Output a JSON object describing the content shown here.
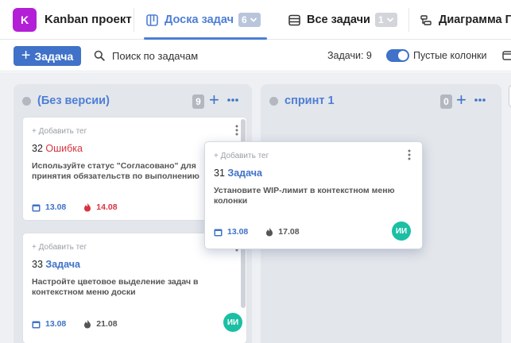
{
  "project": {
    "logo_letter": "K",
    "name": "Kanban проект",
    "logo_color": "#b31fd6"
  },
  "tabs": [
    {
      "label": "Доска задач",
      "badge": "6",
      "icon": "board-icon",
      "active": true
    },
    {
      "label": "Все задачи",
      "badge": "1",
      "icon": "list-icon",
      "active": false
    },
    {
      "label": "Диаграмма Г",
      "icon": "gantt-icon",
      "active": false
    }
  ],
  "toolbar": {
    "add_label": "Задача",
    "search_placeholder": "Поиск по задачам",
    "task_count": "Задачи: 9",
    "empty_columns_label": "Пустые колонки",
    "empty_columns_on": true
  },
  "columns": [
    {
      "title": "(Без версии)",
      "count": "9",
      "cards": [
        {
          "tag": "+ Добавить тег",
          "number": "32",
          "kind": "Ошибка",
          "description_lines": [
            "Используйте статус \"Согласовано\" для",
            "принятия обязательств по выполнению"
          ],
          "date": "13.08",
          "deadline": "14.08",
          "deadline_overdue": true
        },
        {
          "tag": "+ Добавить тег",
          "number": "33",
          "kind": "Задача",
          "description_lines": [
            "Настройте цветовое выделение задач в",
            "контекстном меню доски"
          ],
          "date": "13.08",
          "deadline": "21.08",
          "deadline_overdue": false,
          "avatar": "ИИ"
        }
      ]
    },
    {
      "title": "спринт 1",
      "count": "0",
      "cards": []
    }
  ],
  "dragged_card": {
    "tag": "+ Добавить тег",
    "number": "31",
    "kind": "Задача",
    "description_lines": [
      "Установите WIP-лимит в контекстном меню",
      "колонки"
    ],
    "date": "13.08",
    "deadline": "17.08",
    "avatar": "ИИ"
  },
  "colors": {
    "accent": "#3f72c8",
    "link": "#4d7ed6",
    "bug": "#d9333f",
    "avatar": "#1bbfa4",
    "board_bg": "#eef0f4",
    "column_bg": "#e3e6eb"
  }
}
